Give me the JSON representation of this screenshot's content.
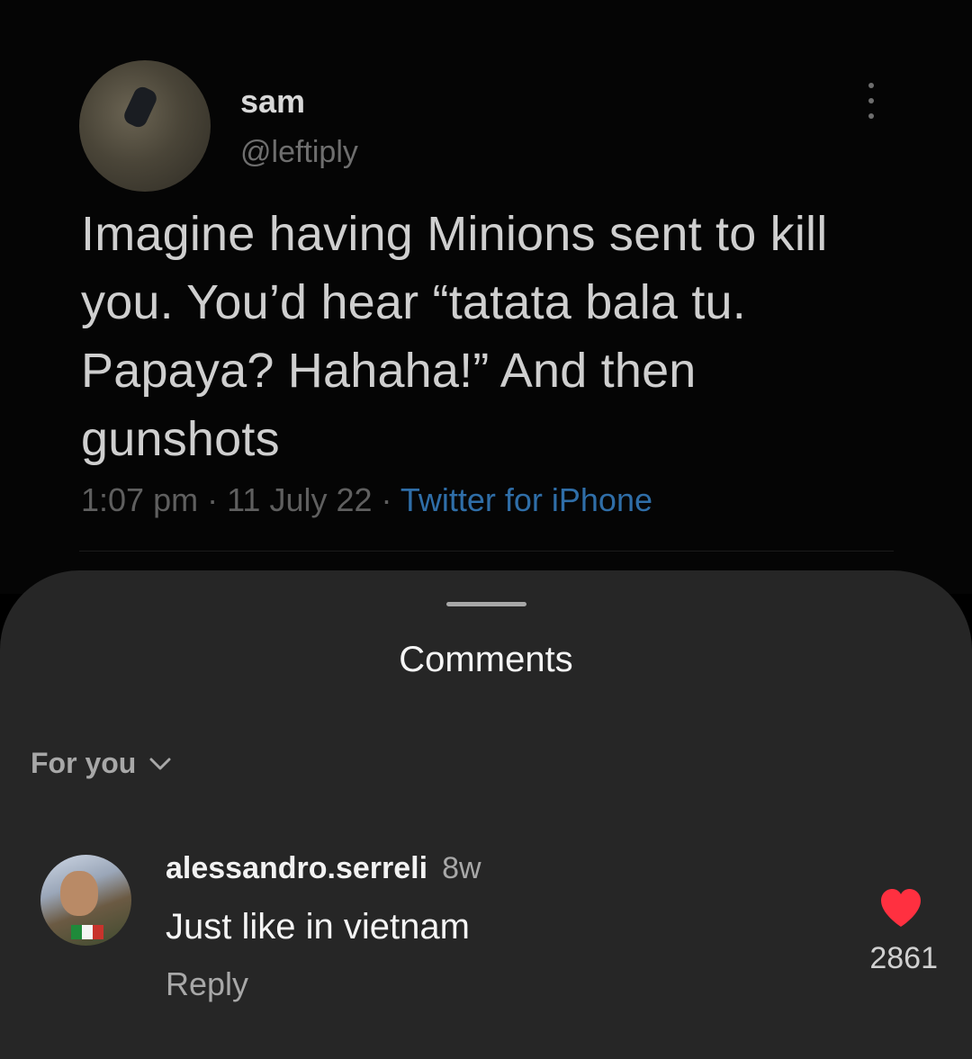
{
  "tweet": {
    "name": "sam",
    "handle": "@leftiply",
    "text": "Imagine having Minions sent to kill you. You’d hear “tatata bala tu. Papaya? Hahaha!” And then gunshots",
    "time": "1:07 pm · 11 July 22 · ",
    "source": "Twitter for iPhone",
    "more_icon": "more-vertical-icon"
  },
  "sheet": {
    "title": "Comments",
    "filter_label": "For you",
    "filter_icon": "chevron-down-icon"
  },
  "comment": {
    "username": "alessandro.serreli",
    "time_ago": "8w",
    "text": "Just like in vietnam",
    "reply_label": "Reply",
    "like_count": "2861",
    "like_icon": "heart-icon",
    "like_color": "#ff3040"
  }
}
